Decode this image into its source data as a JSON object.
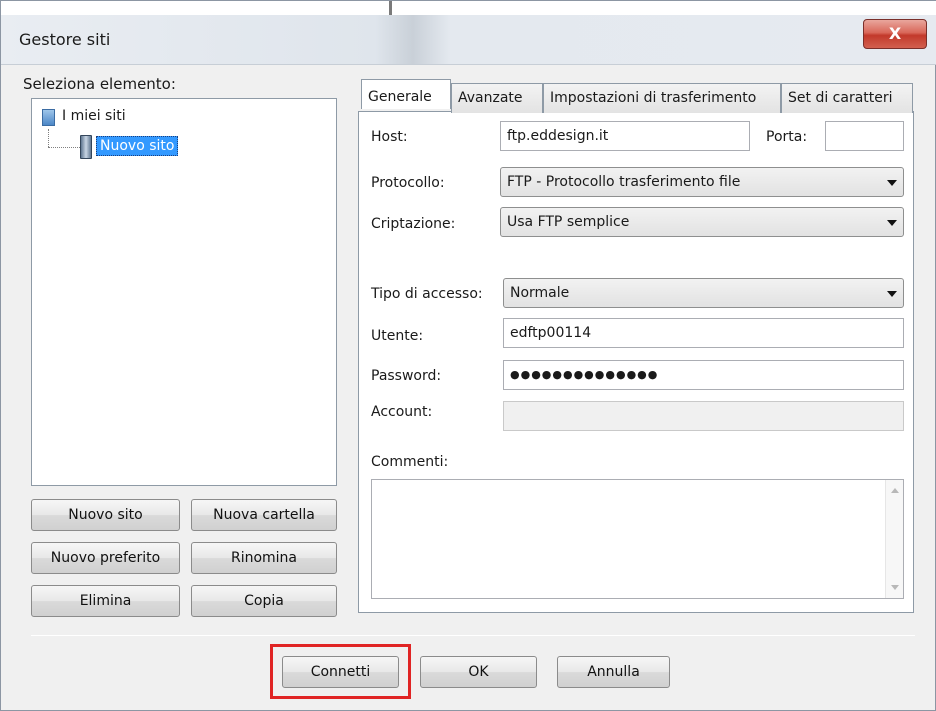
{
  "window": {
    "title": "Gestore siti",
    "close_glyph": "X"
  },
  "left": {
    "label": "Seleziona elemento:",
    "tree": {
      "root": "I miei siti",
      "child": "Nuovo sito"
    },
    "buttons": {
      "new_site": "Nuovo sito",
      "new_folder": "Nuova cartella",
      "new_bookmark": "Nuovo preferito",
      "rename": "Rinomina",
      "delete": "Elimina",
      "copy": "Copia"
    }
  },
  "tabs": [
    "Generale",
    "Avanzate",
    "Impostazioni di trasferimento",
    "Set di caratteri"
  ],
  "general": {
    "host_label": "Host:",
    "host_value": "ftp.eddesign.it",
    "port_label": "Porta:",
    "port_value": "",
    "protocol_label": "Protocollo:",
    "protocol_value": "FTP - Protocollo trasferimento file",
    "encryption_label": "Criptazione:",
    "encryption_value": "Usa FTP semplice",
    "access_type_label": "Tipo di accesso:",
    "access_type_value": "Normale",
    "user_label": "Utente:",
    "user_value": "edftp00114",
    "password_label": "Password:",
    "password_value": "●●●●●●●●●●●●●●",
    "account_label": "Account:",
    "account_value": "",
    "comments_label": "Commenti:",
    "comments_value": ""
  },
  "footer": {
    "connect": "Connetti",
    "ok": "OK",
    "cancel": "Annulla"
  },
  "colors": {
    "selection": "#3399ff",
    "highlight": "#e02424",
    "close_button": "#c2392b"
  }
}
